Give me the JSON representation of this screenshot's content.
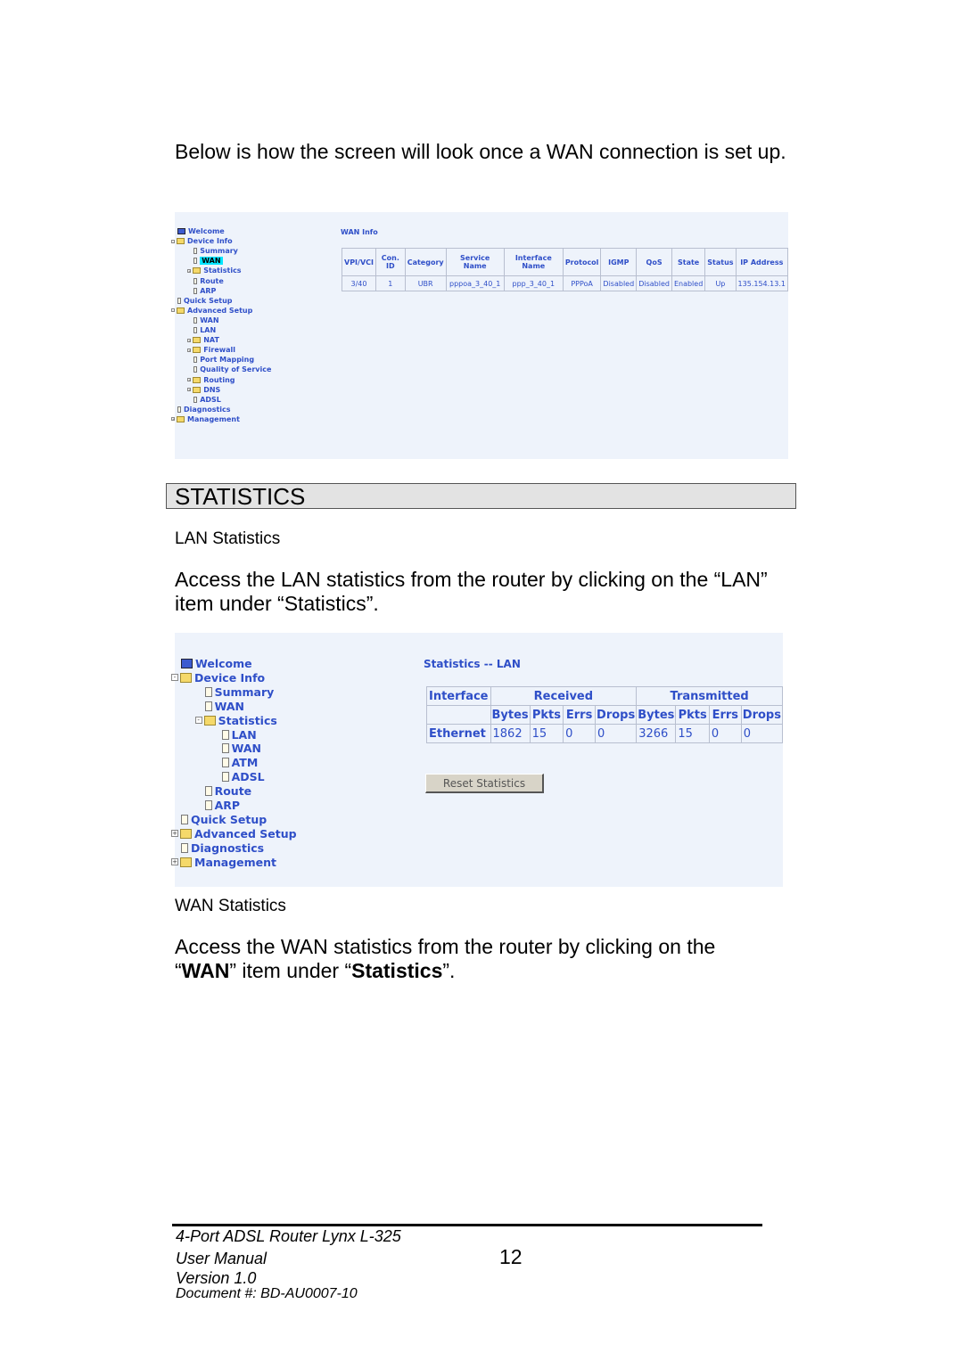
{
  "intro": "Below is how the screen will look once a WAN connection is set up.",
  "wan_panel": {
    "title": "WAN Info",
    "tree": [
      {
        "l": 0,
        "t": "Welcome",
        "i": "monitor"
      },
      {
        "l": 0,
        "t": "Device Info",
        "i": "folder-open",
        "e": "-"
      },
      {
        "l": 1,
        "t": "Summary",
        "i": "page"
      },
      {
        "l": 1,
        "t": "WAN",
        "i": "page",
        "sel": true
      },
      {
        "l": 1,
        "t": "Statistics",
        "i": "folder",
        "e": "+"
      },
      {
        "l": 1,
        "t": "Route",
        "i": "page"
      },
      {
        "l": 1,
        "t": "ARP",
        "i": "page"
      },
      {
        "l": 0,
        "t": "Quick Setup",
        "i": "page"
      },
      {
        "l": 0,
        "t": "Advanced Setup",
        "i": "folder-open",
        "e": "-"
      },
      {
        "l": 1,
        "t": "WAN",
        "i": "page"
      },
      {
        "l": 1,
        "t": "LAN",
        "i": "page"
      },
      {
        "l": 1,
        "t": "NAT",
        "i": "folder",
        "e": "+"
      },
      {
        "l": 1,
        "t": "Firewall",
        "i": "folder",
        "e": "+"
      },
      {
        "l": 1,
        "t": "Port Mapping",
        "i": "page"
      },
      {
        "l": 1,
        "t": "Quality of Service",
        "i": "page"
      },
      {
        "l": 1,
        "t": "Routing",
        "i": "folder",
        "e": "+"
      },
      {
        "l": 1,
        "t": "DNS",
        "i": "folder",
        "e": "+"
      },
      {
        "l": 1,
        "t": "ADSL",
        "i": "page"
      },
      {
        "l": 0,
        "t": "Diagnostics",
        "i": "page"
      },
      {
        "l": 0,
        "t": "Management",
        "i": "folder",
        "e": "+"
      }
    ],
    "headers": [
      "VPI/VCI",
      "Con. ID",
      "Category",
      "Service Name",
      "Interface Name",
      "Protocol",
      "IGMP",
      "QoS",
      "State",
      "Status",
      "IP Address"
    ],
    "row": [
      "3/40",
      "1",
      "UBR",
      "pppoa_3_40_1",
      "ppp_3_40_1",
      "PPPoA",
      "Disabled",
      "Disabled",
      "Enabled",
      "Up",
      "135.154.13.1"
    ]
  },
  "section_title": "STATISTICS",
  "lan_heading": "LAN Statistics",
  "lan_text": "Access the LAN statistics from the router by clicking on the “LAN” item under “Statistics”.",
  "lan_panel": {
    "title": "Statistics -- LAN",
    "tree": [
      {
        "l": 0,
        "t": "Welcome",
        "i": "monitor"
      },
      {
        "l": 0,
        "t": "Device Info",
        "i": "folder-open",
        "e": "-"
      },
      {
        "l": 1,
        "t": "Summary",
        "i": "page"
      },
      {
        "l": 1,
        "t": "WAN",
        "i": "page"
      },
      {
        "l": 1,
        "t": "Statistics",
        "i": "folder-open",
        "e": "-"
      },
      {
        "l": 2,
        "t": "LAN",
        "i": "page"
      },
      {
        "l": 2,
        "t": "WAN",
        "i": "page"
      },
      {
        "l": 2,
        "t": "ATM",
        "i": "page"
      },
      {
        "l": 2,
        "t": "ADSL",
        "i": "page"
      },
      {
        "l": 1,
        "t": "Route",
        "i": "page"
      },
      {
        "l": 1,
        "t": "ARP",
        "i": "page"
      },
      {
        "l": 0,
        "t": "Quick Setup",
        "i": "page"
      },
      {
        "l": 0,
        "t": "Advanced Setup",
        "i": "folder",
        "e": "+"
      },
      {
        "l": 0,
        "t": "Diagnostics",
        "i": "page"
      },
      {
        "l": 0,
        "t": "Management",
        "i": "folder",
        "e": "+"
      }
    ],
    "col_interface": "Interface",
    "col_received": "Received",
    "col_transmitted": "Transmitted",
    "subheaders": [
      "Bytes",
      "Pkts",
      "Errs",
      "Drops",
      "Bytes",
      "Pkts",
      "Errs",
      "Drops"
    ],
    "row_label": "Ethernet",
    "row": [
      "1862",
      "15",
      "0",
      "0",
      "3266",
      "15",
      "0",
      "0"
    ],
    "reset_button": "Reset Statistics"
  },
  "wan_heading": "WAN Statistics",
  "wan_text_1": "Access the WAN statistics from the router by clicking on the",
  "wan_text_q1": "“",
  "wan_text_b1": "WAN",
  "wan_text_2": "” item under “",
  "wan_text_b2": "Statistics",
  "wan_text_3": "”.",
  "footer": {
    "line1": "4-Port ADSL Router Lynx L-325",
    "line2": "User Manual",
    "line3": "Version 1.0",
    "line4": "Document #:  BD-AU0007-10",
    "page": "12"
  },
  "colors": {
    "link_blue": "#2f4fc8",
    "panel_bg": "#eef3fb",
    "selected": "#00e5ff"
  }
}
